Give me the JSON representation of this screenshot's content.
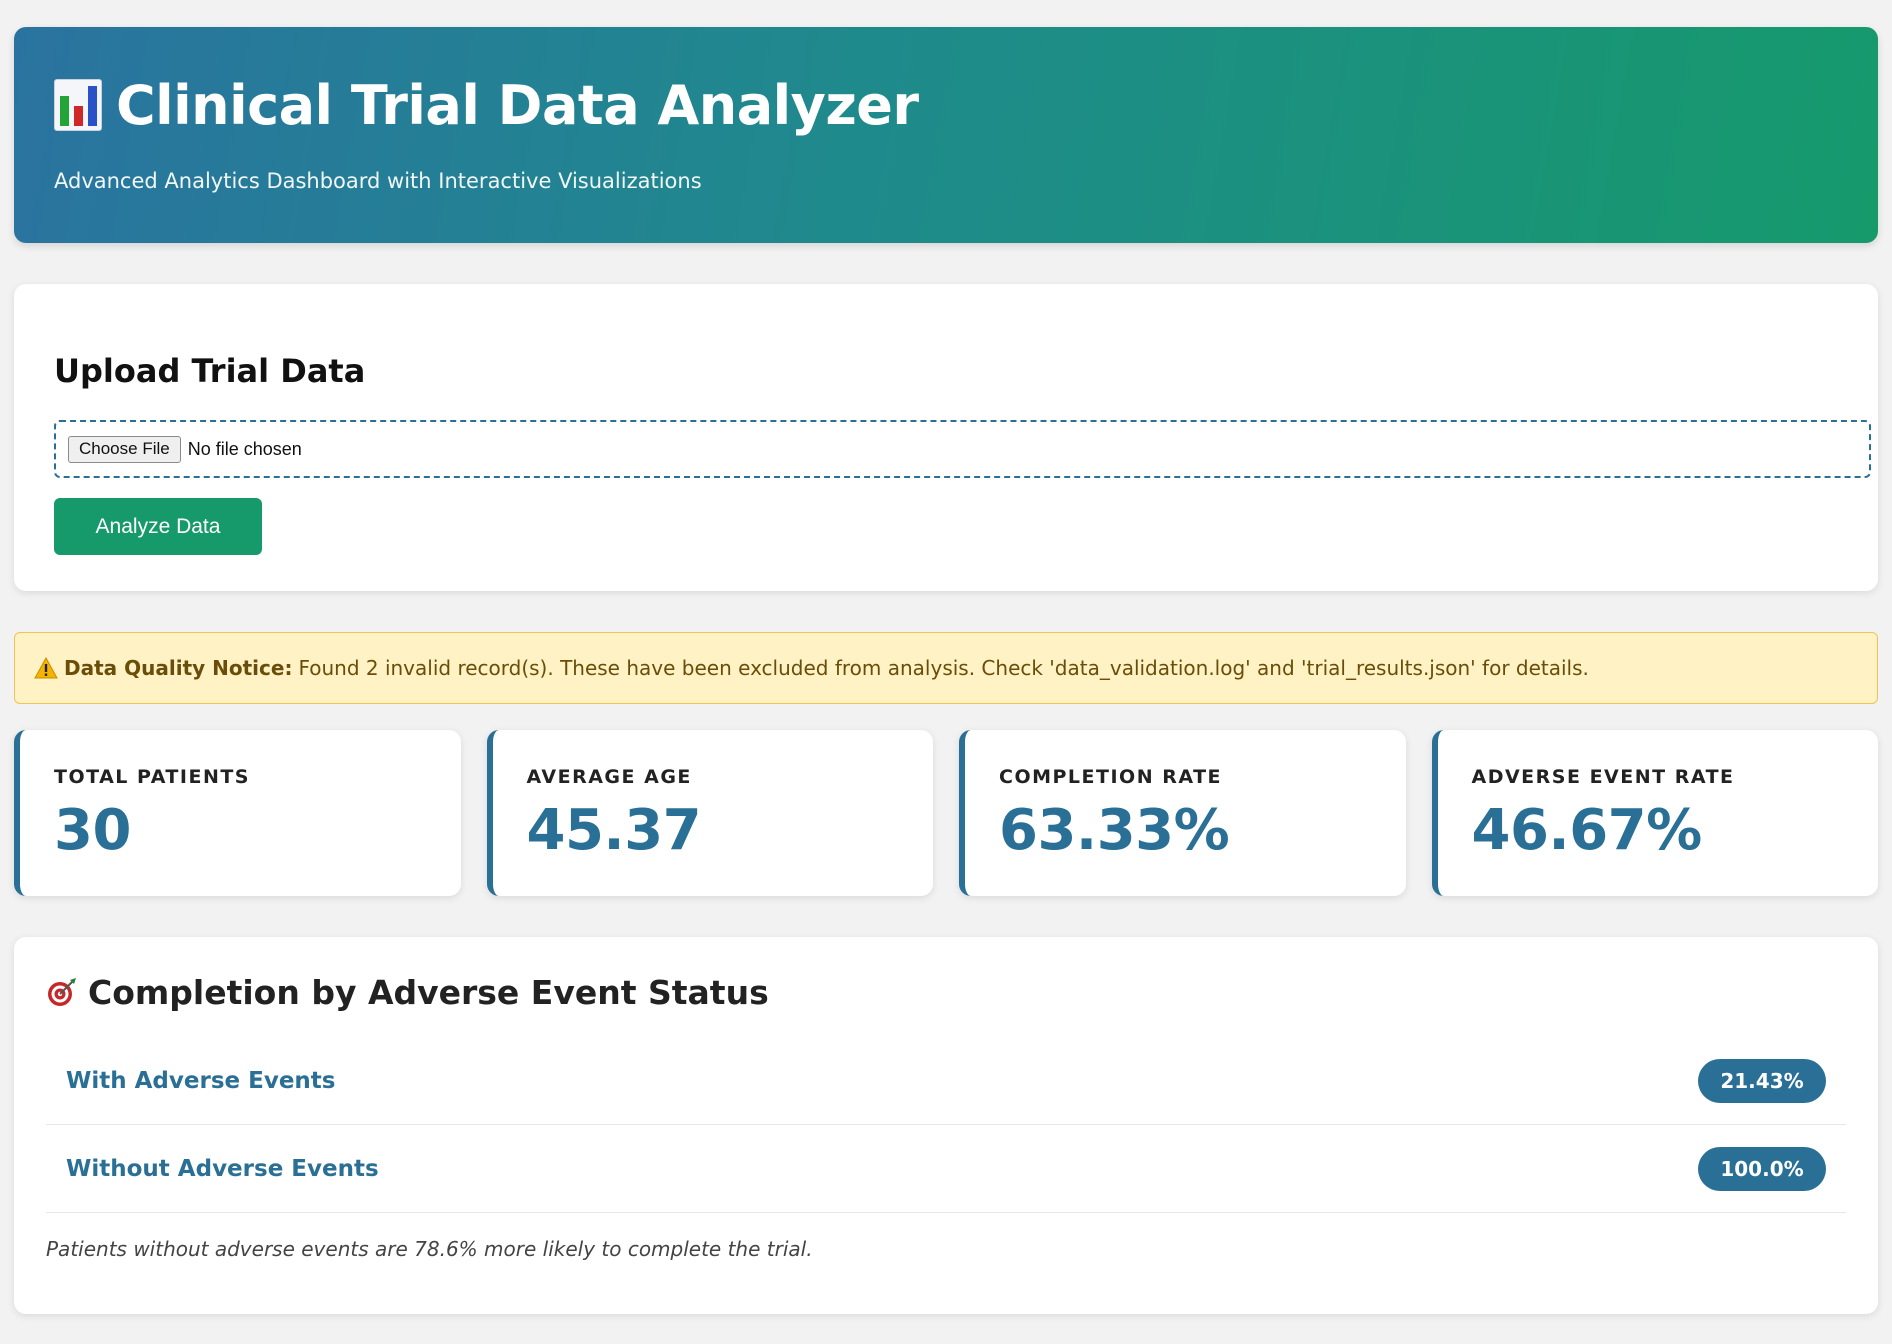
{
  "header": {
    "title": "Clinical Trial Data Analyzer",
    "subtitle": "Advanced Analytics Dashboard with Interactive Visualizations",
    "icon": "bar-chart-icon",
    "gradient_start": "#2a73a0",
    "gradient_end": "#169a6c"
  },
  "upload": {
    "heading": "Upload Trial Data",
    "choose_file_label": "Choose File",
    "file_status": "No file chosen",
    "analyze_label": "Analyze Data"
  },
  "notice": {
    "icon": "warning-icon",
    "label": "Data Quality Notice:",
    "message": "Found 2 invalid record(s). These have been excluded from analysis. Check 'data_validation.log' and 'trial_results.json' for details."
  },
  "stats": [
    {
      "label": "TOTAL PATIENTS",
      "value": "30"
    },
    {
      "label": "AVERAGE AGE",
      "value": "45.37"
    },
    {
      "label": "COMPLETION RATE",
      "value": "63.33%"
    },
    {
      "label": "ADVERSE EVENT RATE",
      "value": "46.67%"
    }
  ],
  "completion": {
    "icon": "target-icon",
    "title": "Completion by Adverse Event Status",
    "rows": [
      {
        "label": "With Adverse Events",
        "value": "21.43%"
      },
      {
        "label": "Without Adverse Events",
        "value": "100.0%"
      }
    ],
    "note": "Patients without adverse events are 78.6% more likely to complete the trial."
  },
  "colors": {
    "accent": "#2a6f95",
    "success": "#169a6c",
    "notice_bg": "#fff2c4",
    "notice_border": "#f1c451"
  }
}
